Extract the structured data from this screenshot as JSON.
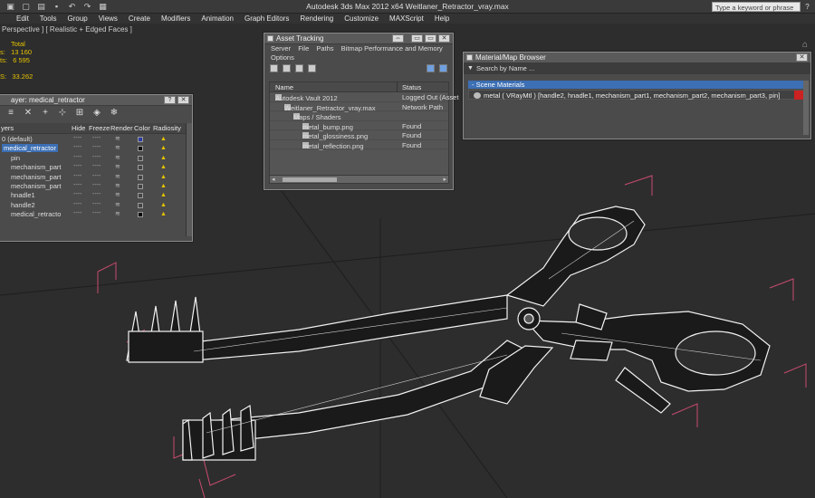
{
  "titlebar": {
    "title": "Autodesk 3ds Max 2012 x64      Weitlaner_Retractor_vray.max",
    "search_placeholder": "Type a keyword or phrase"
  },
  "menu": [
    "Edit",
    "Tools",
    "Group",
    "Views",
    "Create",
    "Modifiers",
    "Animation",
    "Graph Editors",
    "Rendering",
    "Customize",
    "MAXScript",
    "Help"
  ],
  "viewport": {
    "label": "Perspective ] [ Realistic + Edged Faces ]",
    "stats": {
      "header": "Total",
      "polys": "13 160",
      "verts": "6 595",
      "fps": "33.262",
      "polys_label": "s:",
      "verts_label": "ts:",
      "fps_label": "S:"
    }
  },
  "layer_window": {
    "title": "ayer: medical_retractor",
    "headers": {
      "layers": "yers",
      "hide": "Hide",
      "freeze": "Freeze",
      "render": "Render",
      "color": "Color",
      "radiosity": "Radiosity"
    },
    "rows": [
      {
        "name": "0 (default)",
        "color": "#2a3aa8"
      },
      {
        "name": "medical_retractor",
        "color": "#111111",
        "selected": true
      },
      {
        "name": "pin",
        "color": "#444444"
      },
      {
        "name": "mechanism_part",
        "color": "#444444"
      },
      {
        "name": "mechanism_part",
        "color": "#444444"
      },
      {
        "name": "mechanism_part",
        "color": "#444444"
      },
      {
        "name": "hnadle1",
        "color": "#444444"
      },
      {
        "name": "handle2",
        "color": "#444444"
      },
      {
        "name": "medical_retracto",
        "color": "#050505"
      }
    ],
    "dash": "----",
    "render_glyph": "≋",
    "radiosity_glyph": "▲"
  },
  "asset_tracking": {
    "title": "Asset Tracking",
    "menu": [
      "Server",
      "File",
      "Paths",
      "Bitmap Performance and Memory"
    ],
    "menu2": [
      "Options"
    ],
    "columns": {
      "name": "Name",
      "status": "Status"
    },
    "rows": [
      {
        "name": "Autodesk Vault 2012",
        "status": "Logged Out (Asset",
        "indent": 0
      },
      {
        "name": "Weitlaner_Retractor_vray.max",
        "status": "Network Path",
        "indent": 1
      },
      {
        "name": "Maps / Shaders",
        "status": "",
        "indent": 2
      },
      {
        "name": "metal_bump.png",
        "status": "Found",
        "indent": 3
      },
      {
        "name": "metal_glossiness.png",
        "status": "Found",
        "indent": 3
      },
      {
        "name": "metal_reflection.png",
        "status": "Found",
        "indent": 3
      }
    ]
  },
  "material_browser": {
    "title": "Material/Map Browser",
    "search_placeholder": "Search by Name ...",
    "group": "- Scene Materials",
    "material": "metal  ( VRayMtl ) [handle2, hnadle1, mechanism_part1, mechanism_part2, mechanism_part3, pin]"
  }
}
